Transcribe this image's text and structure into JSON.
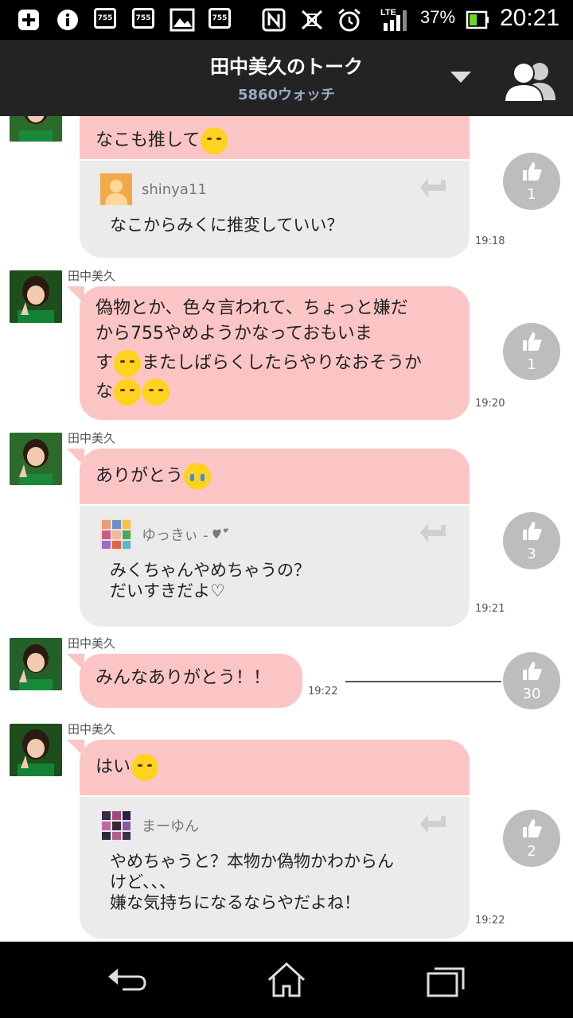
{
  "status_bar": {
    "battery_percent": "37%",
    "time": "20:21",
    "network": "LTE",
    "icons": [
      "plus-icon",
      "info-icon",
      "app-755-icon",
      "app-755-icon",
      "image-icon",
      "app-755-icon",
      "nfc-icon",
      "vibrate-off-icon",
      "alarm-icon",
      "signal-icon",
      "battery-icon"
    ]
  },
  "header": {
    "title": "田中美久のトーク",
    "watch_count": "5860ウォッチ",
    "dropdown_icon": "caret-down-icon",
    "members_icon": "members-icon"
  },
  "messages": [
    {
      "sender": "",
      "text_parts": [
        "なこも推して"
      ],
      "time": "19:18",
      "likes": "1",
      "quote": {
        "user": "shinya11",
        "text": "なこからみくに推変していい？"
      }
    },
    {
      "sender": "田中美久",
      "text_line1": "偽物とか、色々言われて、ちょっと嫌だ",
      "text_line2": "から755やめようかなっておもいま",
      "text_line3_a": "す",
      "text_line3_b": "またしばらくしたらやりなおそうか",
      "text_line4": "な",
      "time": "19:20",
      "likes": "1"
    },
    {
      "sender": "田中美久",
      "text": "ありがとう",
      "time": "19:21",
      "likes": "3",
      "quote": {
        "user": "ゆっきぃ - ",
        "text": "みくちゃんやめちゃうの？\nだいすきだよ♡"
      }
    },
    {
      "sender": "田中美久",
      "text": "みんなありがとう！！",
      "time": "19:22",
      "likes": "30"
    },
    {
      "sender": "田中美久",
      "text": "はい",
      "time": "19:22",
      "likes": "2",
      "quote": {
        "user": "まーゆん",
        "text": "やめちゃうと？本物か偽物かわからん\nけど、、、\n嫌な気持ちになるならやだよね！"
      }
    }
  ],
  "colors": {
    "header_bg": "#232323",
    "bubble_pink": "#fcc5c5",
    "quote_gray": "#ebebeb",
    "like_gray": "#bdbdbd",
    "watch_blue": "#9aaac4"
  },
  "nav": {
    "back_icon": "back-icon",
    "home_icon": "home-icon",
    "recents_icon": "recent-apps-icon"
  }
}
